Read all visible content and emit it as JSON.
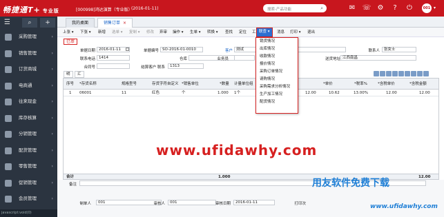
{
  "topbar": {
    "logo": "畅捷通T+",
    "edition": "专业版",
    "company": "[000998]鸿达演算（专业版）",
    "period": "(2016-01-11)",
    "search_placeholder": "搜索-产品功能",
    "user": "001"
  },
  "sidebar": {
    "items": [
      {
        "label": "采购管理"
      },
      {
        "label": "销售管理"
      },
      {
        "label": "订货商城"
      },
      {
        "label": "电商通"
      },
      {
        "label": "往来现金"
      },
      {
        "label": "库存核算"
      },
      {
        "label": "分销管理"
      },
      {
        "label": "配货管理"
      },
      {
        "label": "零售管理"
      },
      {
        "label": "促销管理"
      },
      {
        "label": "会员管理"
      }
    ],
    "status": "javascript:void(0)"
  },
  "tabs": [
    {
      "label": "我的桌面"
    },
    {
      "label": "销售订单"
    }
  ],
  "toolbar": {
    "items": [
      "上张 ▾",
      "下张 ▾",
      "新增",
      "选单 ▾",
      "复制 ▾",
      "修改",
      "弃审",
      "操作 ▾",
      "生单 ▾",
      "转换 ▾",
      "查找",
      "定位",
      "工具 ▾",
      "联查 ▾",
      "消息",
      "打印 ▾",
      "退出"
    ]
  },
  "menu": {
    "items": [
      "销货情况",
      "出库情况",
      "收款情况",
      "报价情况",
      "采购订单情况",
      "请购情况",
      "采购需求分析情况",
      "生产加工情况",
      "配货情况"
    ]
  },
  "form": {
    "stamp": "已审",
    "doc_date_label": "单据日期",
    "doc_date": "2016-01-11",
    "doc_no_label": "单据编号",
    "doc_no": "SO-2016-01-0010",
    "customer_label": "客户",
    "customer": "测试",
    "contact_label": "联系人",
    "contact": "张女士",
    "phone_label": "联系电话",
    "phone": "1414",
    "warehouse_label": "仓库",
    "salesman_label": "业务员",
    "delivery_label": "送货地址",
    "delivery": "江西南昌",
    "contract_label": "合同号",
    "settle_label": "结算客户 联系",
    "settle": "1313"
  },
  "grid": {
    "tabs": [
      "明细",
      "汇总"
    ],
    "headers": [
      "序号",
      "*存货名称",
      "规格型号",
      "存货字符自定义",
      "*销售单位",
      "*数量",
      "计量单位组",
      "税率",
      "*单价",
      "*税率%",
      "*含税单价",
      "*含税金额"
    ],
    "rows": [
      [
        "1",
        "06001",
        "11",
        "红色",
        "个",
        "1.000",
        "1个",
        "",
        "12.00",
        "10.62",
        "13.00%",
        "12.00",
        "12.00"
      ]
    ],
    "total_label": "合计",
    "total_qty": "1.000",
    "total_amount": "12.00"
  },
  "footer": {
    "remark_label": "备注",
    "maker_label": "制单人",
    "maker": "001",
    "auditor_label": "审核人",
    "auditor": "001",
    "audit_date_label": "审核日期",
    "audit_date": "2016-01-11",
    "print_label": "打印次"
  },
  "watermark": {
    "url": "www.ufidawhy.com",
    "brand": "用友软件免费下载",
    "url2": "www.ufidawhy.com"
  },
  "colors": {
    "brand": "#c8161e",
    "sidebar": "#2b3440",
    "menu_highlight": "#d62020"
  }
}
